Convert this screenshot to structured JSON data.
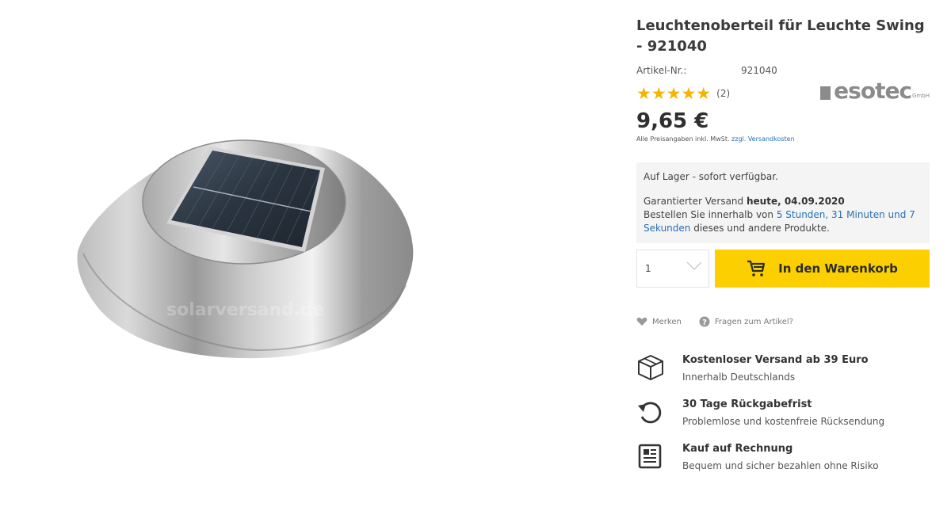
{
  "product": {
    "title": "Leuchtenoberteil für Leuchte Swing - 921040",
    "article_label": "Artikel-Nr.:",
    "article_number": "921040",
    "stars": "★★★★★",
    "rating": 5,
    "review_count": "(2)",
    "brand": "esotec",
    "brand_suffix": "GmbH",
    "watermark": "solarversand.de",
    "price": "9,65 €",
    "vat_text": "Alle Preisangaben inkl. MwSt.",
    "shipping_link": "zzgl. Versandkosten"
  },
  "stock": {
    "availability": "Auf Lager - sofort verfügbar.",
    "guarantee_prefix": "Garantierter Versand",
    "guarantee_date": "heute, 04.09.2020",
    "order_prefix": "Bestellen Sie innerhalb von",
    "order_time": "5 Stunden, 31 Minuten und 7 Sekunden",
    "order_suffix": "dieses und andere Produkte."
  },
  "buy": {
    "quantity": "1",
    "cart_label": "In den Warenkorb"
  },
  "actions": {
    "wishlist": "Merken",
    "question": "Fragen zum Artikel?"
  },
  "features": [
    {
      "icon": "box-icon",
      "title": "Kostenloser Versand ab 39 Euro",
      "subtitle": "Innerhalb Deutschlands"
    },
    {
      "icon": "return-icon",
      "title": "30 Tage Rückgabefrist",
      "subtitle": "Problemlose und kostenfreie Rücksendung"
    },
    {
      "icon": "invoice-icon",
      "title": "Kauf auf Rechnung",
      "subtitle": "Bequem und sicher bezahlen ohne Risiko"
    }
  ],
  "colors": {
    "accent": "#fcd000",
    "link": "#2a6fb4",
    "star": "#f4b400",
    "box_bg": "#f4f4f4"
  }
}
